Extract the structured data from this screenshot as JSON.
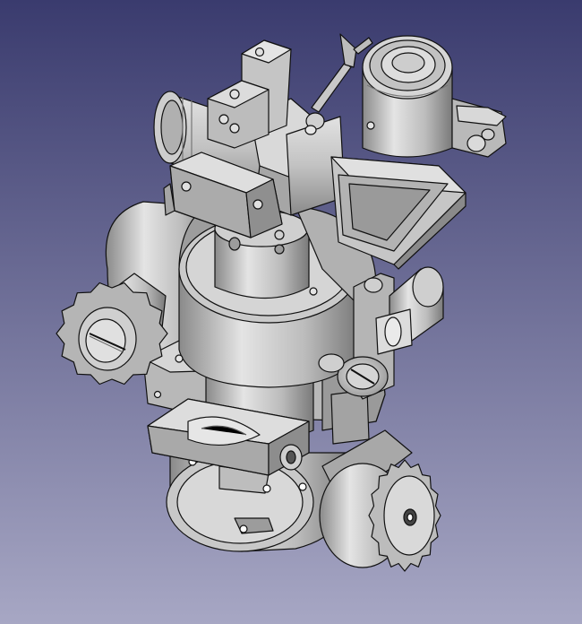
{
  "viewport": {
    "background": {
      "top": "#3a3b6e",
      "bottom": "#a7a7c4"
    },
    "body_colors": {
      "light": "#e2e2e2",
      "mid": "#bdbdbd",
      "dark": "#7f7f7f",
      "edge": "#111111"
    }
  },
  "model": {
    "components": [
      "eyepiece-icon",
      "prism-housing-icon",
      "focus-knob-icon",
      "azimuth-knob-icon",
      "lens-tube-icon",
      "clamp-block-icon",
      "level-vial-icon",
      "base-drum-icon"
    ]
  }
}
